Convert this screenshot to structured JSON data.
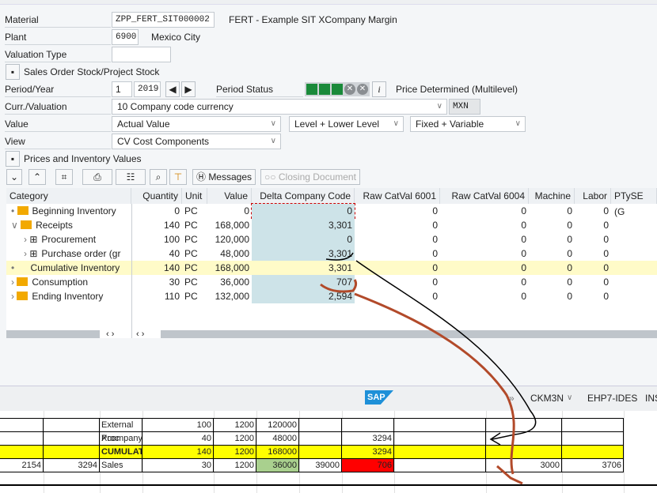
{
  "header": {
    "material_label": "Material",
    "material_value": "ZPP_FERT_SIT000002",
    "material_desc": "FERT - Example SIT XCompany Margin",
    "plant_label": "Plant",
    "plant_value": "6900",
    "plant_desc": "Mexico City",
    "valuation_type_label": "Valuation Type",
    "valuation_type_value": "",
    "sales_order_stock_label": "Sales Order Stock/Project Stock",
    "period_year_label": "Period/Year",
    "period_value": "1",
    "year_value": "2019",
    "period_status_label": "Period Status",
    "period_status_text": "Price Determined (Multilevel)",
    "curr_label": "Curr./Valuation",
    "curr_value": "10 Company code currency",
    "currency": "MXN",
    "value_label": "Value",
    "value_value": "Actual Value",
    "level_value": "Level + Lower Level",
    "fixvar_value": "Fixed + Variable",
    "view_label": "View",
    "view_value": "CV Cost Components",
    "prices_section_label": "Prices and Inventory Values"
  },
  "toolbar": {
    "messages_label": "Messages",
    "closing_document_label": "Closing Document"
  },
  "grid": {
    "columns": [
      "Category",
      "Quantity",
      "Unit",
      "Value",
      "Delta Company Code",
      "Raw CatVal 6001",
      "Raw  CatVal 6004",
      "Machine",
      "Labor",
      "PTySE (G"
    ],
    "rows": [
      {
        "category": "Beginning Inventory",
        "qty": "0",
        "unit": "PC",
        "value": "0",
        "delta": "0",
        "raw6001": "0",
        "raw6004": "0",
        "machine": "0",
        "labor": "0"
      },
      {
        "category": "Receipts",
        "qty": "140",
        "unit": "PC",
        "value": "168,000",
        "delta": "3,301",
        "raw6001": "0",
        "raw6004": "0",
        "machine": "0",
        "labor": "0"
      },
      {
        "category": "Procurement",
        "qty": "100",
        "unit": "PC",
        "value": "120,000",
        "delta": "0",
        "raw6001": "0",
        "raw6004": "0",
        "machine": "0",
        "labor": "0"
      },
      {
        "category": "Purchase order (gr",
        "qty": "40",
        "unit": "PC",
        "value": "48,000",
        "delta": "3,301",
        "raw6001": "0",
        "raw6004": "0",
        "machine": "0",
        "labor": "0"
      },
      {
        "category": "Cumulative Inventory",
        "qty": "140",
        "unit": "PC",
        "value": "168,000",
        "delta": "3,301",
        "raw6001": "0",
        "raw6004": "0",
        "machine": "0",
        "labor": "0"
      },
      {
        "category": "Consumption",
        "qty": "30",
        "unit": "PC",
        "value": "36,000",
        "delta": "707",
        "raw6001": "0",
        "raw6004": "0",
        "machine": "0",
        "labor": "0"
      },
      {
        "category": "Ending Inventory",
        "qty": "110",
        "unit": "PC",
        "value": "132,000",
        "delta": "2,594",
        "raw6001": "0",
        "raw6004": "0",
        "machine": "0",
        "labor": "0"
      }
    ]
  },
  "status_bar": {
    "logo": "SAP",
    "transaction": "CKM3N",
    "system": "EHP7-IDES",
    "client": "INS"
  },
  "spreadsheet": {
    "rows": [
      {
        "cells": [
          "",
          "",
          "External Proc",
          "100",
          "1200",
          "120000",
          "",
          "",
          "",
          "",
          ""
        ]
      },
      {
        "cells": [
          "",
          "",
          "Xcompany",
          "40",
          "1200",
          "48000",
          "",
          "3294",
          "",
          "",
          ""
        ]
      },
      {
        "cells": [
          "",
          "",
          "CUMULATIVE STC",
          "140",
          "1200",
          "168000",
          "",
          "3294",
          "",
          "",
          ""
        ]
      },
      {
        "cells": [
          "2154",
          "3294",
          "Sales",
          "30",
          "1200",
          "36000",
          "39000",
          "706",
          "",
          "3000",
          "3706"
        ]
      }
    ]
  },
  "colors": {
    "highlight_row": "#fffbc8",
    "delta_col": "#cde3e8",
    "excel_yellow": "#ffff00",
    "excel_red": "#ff0000",
    "excel_green": "#a9d08e",
    "status_green": "#1a8a3a"
  }
}
